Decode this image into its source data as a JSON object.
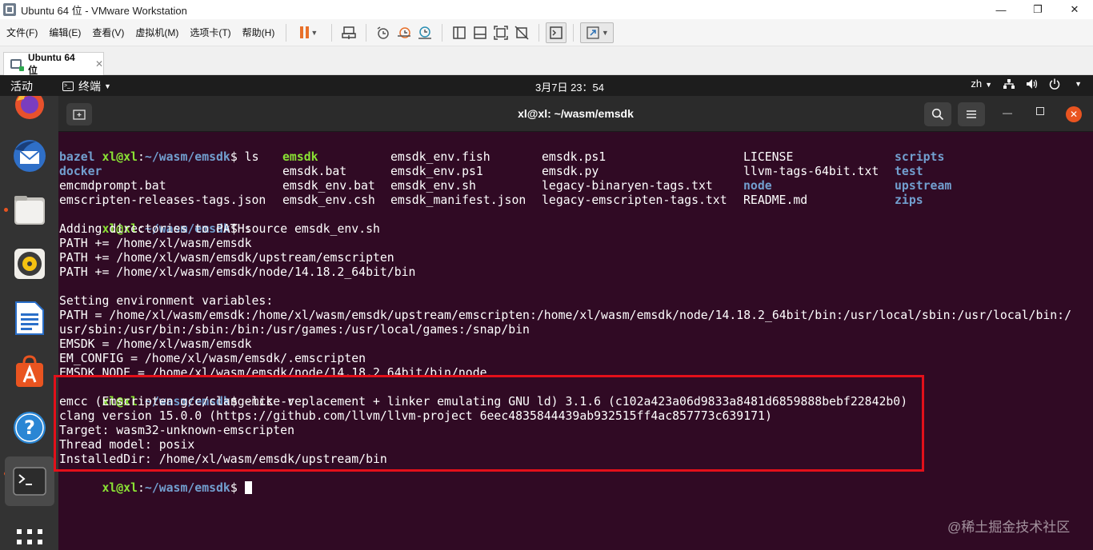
{
  "window": {
    "title": "Ubuntu 64 位 - VMware Workstation",
    "controls": [
      "—",
      "❐",
      "✕"
    ]
  },
  "menu": [
    "文件(F)",
    "编辑(E)",
    "查看(V)",
    "虚拟机(M)",
    "选项卡(T)",
    "帮助(H)"
  ],
  "toolbar_icons": [
    "pause-icon",
    "send-ctrl-alt-del-icon",
    "snapshot-icon",
    "revert-snapshot-icon",
    "manage-snapshots-icon",
    "sidebar-icon",
    "console-view-icon",
    "fit-guest-icon",
    "unity-icon",
    "terminal-icon",
    "fullscreen-icon"
  ],
  "tab": {
    "label": "Ubuntu 64 位",
    "close": "✕"
  },
  "gnome": {
    "activities": "活动",
    "app_menu": "终端",
    "clock": "3月7日 23：54",
    "lang": "zh",
    "network_icon": "network-icon",
    "volume_icon": "volume-icon",
    "power_icon": "power-icon"
  },
  "dock": [
    "firefox-icon",
    "thunderbird-icon",
    "files-icon",
    "rhythmbox-icon",
    "libreoffice-writer-icon",
    "ubuntu-software-icon",
    "help-icon",
    "terminal-icon",
    "show-apps-icon"
  ],
  "terminal": {
    "title": "xl@xl: ~/wasm/emsdk",
    "prompt": {
      "user": "xl@xl",
      "colon": ":",
      "path": "~/wasm/emsdk",
      "dollar": "$ "
    },
    "cmd1": "ls",
    "ls_columns": [
      [
        {
          "t": "bazel",
          "k": "dir"
        },
        {
          "t": "docker",
          "k": "dir"
        },
        {
          "t": "emcmdprompt.bat",
          "k": "file"
        },
        {
          "t": "emscripten-releases-tags.json",
          "k": "file"
        }
      ],
      [
        {
          "t": "emsdk",
          "k": "exe"
        },
        {
          "t": "emsdk.bat",
          "k": "file"
        },
        {
          "t": "emsdk_env.bat",
          "k": "file"
        },
        {
          "t": "emsdk_env.csh",
          "k": "file"
        }
      ],
      [
        {
          "t": "emsdk_env.fish",
          "k": "file"
        },
        {
          "t": "emsdk_env.ps1",
          "k": "file"
        },
        {
          "t": "emsdk_env.sh",
          "k": "file"
        },
        {
          "t": "emsdk_manifest.json",
          "k": "file"
        }
      ],
      [
        {
          "t": "emsdk.ps1",
          "k": "file"
        },
        {
          "t": "emsdk.py",
          "k": "file"
        },
        {
          "t": "legacy-binaryen-tags.txt",
          "k": "file"
        },
        {
          "t": "legacy-emscripten-tags.txt",
          "k": "file"
        }
      ],
      [
        {
          "t": "LICENSE",
          "k": "file"
        },
        {
          "t": "llvm-tags-64bit.txt",
          "k": "file"
        },
        {
          "t": "node",
          "k": "dir"
        },
        {
          "t": "README.md",
          "k": "file"
        }
      ],
      [
        {
          "t": "scripts",
          "k": "dir"
        },
        {
          "t": "test",
          "k": "dir"
        },
        {
          "t": "upstream",
          "k": "dir"
        },
        {
          "t": "zips",
          "k": "dir"
        }
      ]
    ],
    "cmd2": "source emsdk_env.sh",
    "out2": [
      "Adding directories to PATH:",
      "PATH += /home/xl/wasm/emsdk",
      "PATH += /home/xl/wasm/emsdk/upstream/emscripten",
      "PATH += /home/xl/wasm/emsdk/node/14.18.2_64bit/bin",
      "",
      "Setting environment variables:",
      "PATH = /home/xl/wasm/emsdk:/home/xl/wasm/emsdk/upstream/emscripten:/home/xl/wasm/emsdk/node/14.18.2_64bit/bin:/usr/local/sbin:/usr/local/bin:/",
      "usr/sbin:/usr/bin:/sbin:/bin:/usr/games:/usr/local/games:/snap/bin",
      "EMSDK = /home/xl/wasm/emsdk",
      "EM_CONFIG = /home/xl/wasm/emsdk/.emscripten",
      "EMSDK_NODE = /home/xl/wasm/emsdk/node/14.18.2_64bit/bin/node"
    ],
    "cmd3": "emcc -v",
    "out3": [
      "emcc (Emscripten gcc/clang-like replacement + linker emulating GNU ld) 3.1.6 (c102a423a06d9833a8481d6859888bebf22842b0)",
      "clang version 15.0.0 (https://github.com/llvm/llvm-project 6eec4835844439ab932515ff4ac857773c639171)",
      "Target: wasm32-unknown-emscripten",
      "Thread model: posix",
      "InstalledDir: /home/xl/wasm/emsdk/upstream/bin"
    ]
  },
  "watermark": "@稀土掘金技术社区",
  "colors": {
    "terminal_bg": "#300a24",
    "prompt_user": "#8ae234",
    "prompt_path": "#729fcf",
    "highlight": "#e3101a",
    "ubuntu_orange": "#e95420"
  }
}
